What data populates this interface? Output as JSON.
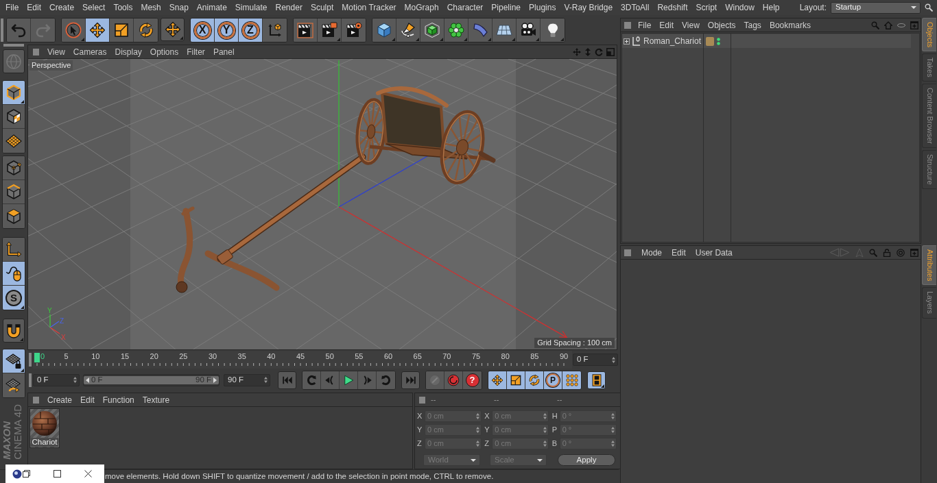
{
  "menu_bar": {
    "items": [
      "File",
      "Edit",
      "Create",
      "Select",
      "Tools",
      "Mesh",
      "Snap",
      "Animate",
      "Simulate",
      "Render",
      "Sculpt",
      "Motion Tracker",
      "MoGraph",
      "Character",
      "Pipeline",
      "Plugins",
      "V-Ray Bridge",
      "3DToAll",
      "Redshift",
      "Script",
      "Window",
      "Help"
    ],
    "layout_label": "Layout:",
    "layout_value": "Startup"
  },
  "toolbar": {
    "groups": [
      [
        {
          "kind": "undo",
          "active": false,
          "disabled": false,
          "submenu": false
        },
        {
          "kind": "redo",
          "active": false,
          "disabled": true,
          "submenu": false
        }
      ],
      [
        {
          "kind": "live-select",
          "active": false,
          "disabled": false,
          "submenu": true
        },
        {
          "kind": "move",
          "active": true,
          "disabled": false,
          "submenu": false
        },
        {
          "kind": "scale",
          "active": false,
          "disabled": false,
          "submenu": false
        },
        {
          "kind": "rotate",
          "active": false,
          "disabled": false,
          "submenu": false
        }
      ],
      [
        {
          "kind": "move",
          "active": false,
          "disabled": false,
          "submenu": true
        }
      ],
      [
        {
          "kind": "axis",
          "label": "X",
          "active": true,
          "disabled": false,
          "submenu": false
        },
        {
          "kind": "axis",
          "label": "Y",
          "active": true,
          "disabled": false,
          "submenu": false
        },
        {
          "kind": "axis",
          "label": "Z",
          "active": true,
          "disabled": false,
          "submenu": false
        },
        {
          "kind": "coords",
          "active": false,
          "disabled": false,
          "submenu": false
        }
      ],
      [
        {
          "kind": "render-view",
          "active": false,
          "disabled": false,
          "submenu": false
        },
        {
          "kind": "render-picture",
          "active": false,
          "disabled": false,
          "submenu": true
        },
        {
          "kind": "render-settings",
          "active": false,
          "disabled": false,
          "submenu": false
        }
      ],
      [
        {
          "kind": "cube",
          "active": false,
          "disabled": false,
          "submenu": true
        },
        {
          "kind": "pen",
          "active": false,
          "disabled": false,
          "submenu": true
        },
        {
          "kind": "subdivision",
          "active": false,
          "disabled": false,
          "submenu": true
        },
        {
          "kind": "cloner",
          "active": false,
          "disabled": false,
          "submenu": true
        },
        {
          "kind": "bend",
          "active": false,
          "disabled": false,
          "submenu": true
        },
        {
          "kind": "floor",
          "active": false,
          "disabled": false,
          "submenu": true
        },
        {
          "kind": "camera",
          "active": false,
          "disabled": false,
          "submenu": true
        },
        {
          "kind": "light",
          "active": false,
          "disabled": false,
          "submenu": true
        }
      ]
    ]
  },
  "tool_palette": {
    "groups": [
      [
        {
          "kind": "globe",
          "active": false,
          "disabled": true,
          "submenu": false
        }
      ],
      [
        {
          "kind": "model",
          "active": true,
          "disabled": false,
          "submenu": true
        },
        {
          "kind": "texture",
          "active": false,
          "disabled": false,
          "submenu": false
        },
        {
          "kind": "workplane",
          "active": false,
          "disabled": false,
          "submenu": false
        }
      ],
      [
        {
          "kind": "points",
          "active": false,
          "disabled": false,
          "submenu": false
        },
        {
          "kind": "edges",
          "active": false,
          "disabled": false,
          "submenu": false
        },
        {
          "kind": "polygons",
          "active": false,
          "disabled": false,
          "submenu": false
        }
      ],
      [
        {
          "kind": "axis-mode",
          "active": false,
          "disabled": false,
          "submenu": false
        },
        {
          "kind": "tweak",
          "active": true,
          "disabled": false,
          "submenu": false
        },
        {
          "kind": "soft",
          "label": "S",
          "active": true,
          "disabled": false,
          "submenu": true
        }
      ],
      [
        {
          "kind": "magnet",
          "active": false,
          "disabled": false,
          "submenu": true
        }
      ],
      [
        {
          "kind": "workplane-lock",
          "active": true,
          "disabled": false,
          "submenu": true
        },
        {
          "kind": "workplane-planar",
          "active": false,
          "disabled": false,
          "submenu": false
        }
      ]
    ]
  },
  "logo": {
    "brand": "MAXON",
    "product": "CINEMA 4D"
  },
  "viewport": {
    "menu": [
      "View",
      "Cameras",
      "Display",
      "Options",
      "Filter",
      "Panel"
    ],
    "camera": "Perspective",
    "grid_info": "Grid Spacing : 100 cm",
    "gizmo": [
      {
        "label": "Y",
        "color": "#3cc83c"
      },
      {
        "label": "Z",
        "color": "#4a64e8"
      },
      {
        "label": "X",
        "color": "#e03c3c"
      }
    ]
  },
  "timeline": {
    "ticks": [
      {
        "label": "0",
        "current": true
      },
      {
        "label": "5",
        "current": false
      },
      {
        "label": "10",
        "current": false
      },
      {
        "label": "15",
        "current": false
      },
      {
        "label": "20",
        "current": false
      },
      {
        "label": "25",
        "current": false
      },
      {
        "label": "30",
        "current": false
      },
      {
        "label": "35",
        "current": false
      },
      {
        "label": "40",
        "current": false
      },
      {
        "label": "45",
        "current": false
      },
      {
        "label": "50",
        "current": false
      },
      {
        "label": "55",
        "current": false
      },
      {
        "label": "60",
        "current": false
      },
      {
        "label": "65",
        "current": false
      },
      {
        "label": "70",
        "current": false
      },
      {
        "label": "75",
        "current": false
      },
      {
        "label": "80",
        "current": false
      },
      {
        "label": "85",
        "current": false
      },
      {
        "label": "90",
        "current": false
      }
    ],
    "playhead": {
      "level": 0
    },
    "frame_field": "0 F"
  },
  "transport": {
    "start_field": "0 F",
    "range": {
      "start": "0 F",
      "end": "90 F",
      "level": 1
    },
    "end_field": "90 F",
    "groups": [
      [
        {
          "kind": "go-start",
          "active": false,
          "disabled": false,
          "submenu": false
        }
      ],
      [
        {
          "kind": "prev-key",
          "active": false,
          "disabled": false,
          "submenu": false
        },
        {
          "kind": "prev-frame",
          "active": false,
          "disabled": false,
          "submenu": false
        },
        {
          "kind": "play",
          "active": false,
          "disabled": false,
          "submenu": false
        },
        {
          "kind": "next-frame",
          "active": false,
          "disabled": false,
          "submenu": false
        },
        {
          "kind": "next-key",
          "active": false,
          "disabled": false,
          "submenu": false
        }
      ],
      [
        {
          "kind": "go-end",
          "active": false,
          "disabled": false,
          "submenu": false
        }
      ],
      [
        {
          "kind": "motion-path",
          "active": false,
          "disabled": true,
          "submenu": false
        },
        {
          "kind": "record",
          "active": false,
          "disabled": false,
          "submenu": false
        },
        {
          "kind": "autokey",
          "label": "?",
          "active": false,
          "disabled": false,
          "submenu": false
        }
      ],
      [
        {
          "kind": "key-position",
          "active": true,
          "disabled": false,
          "submenu": false
        },
        {
          "kind": "key-scale",
          "active": true,
          "disabled": false,
          "submenu": false
        },
        {
          "kind": "key-rotation",
          "active": true,
          "disabled": false,
          "submenu": false
        },
        {
          "kind": "key-parameter",
          "label": "P",
          "active": true,
          "disabled": false,
          "submenu": false
        },
        {
          "kind": "key-pla",
          "active": true,
          "disabled": false,
          "submenu": false
        }
      ],
      [
        {
          "kind": "timeline-film",
          "active": true,
          "disabled": false,
          "submenu": true
        }
      ]
    ]
  },
  "material_manager": {
    "menu": [
      "Create",
      "Edit",
      "Function",
      "Texture"
    ],
    "materials": [
      {
        "name": "Chariot"
      }
    ]
  },
  "coordinates": {
    "headers": [
      "--",
      "--",
      "--"
    ],
    "rows": [
      [
        {
          "axis": "X",
          "value": "0 cm"
        },
        {
          "axis": "X",
          "value": "0 cm"
        },
        {
          "axis": "H",
          "value": "0 °"
        }
      ],
      [
        {
          "axis": "Y",
          "value": "0 cm"
        },
        {
          "axis": "Y",
          "value": "0 cm"
        },
        {
          "axis": "P",
          "value": "0 °"
        }
      ],
      [
        {
          "axis": "Z",
          "value": "0 cm"
        },
        {
          "axis": "Z",
          "value": "0 cm"
        },
        {
          "axis": "B",
          "value": "0 °"
        }
      ]
    ],
    "mode": "World",
    "transform": "Scale",
    "apply": "Apply",
    "disabled": true
  },
  "status_bar": {
    "text": "move elements. Hold down SHIFT to quantize movement / add to the selection in point mode, CTRL to remove."
  },
  "object_manager": {
    "menu": [
      "File",
      "Edit",
      "View",
      "Objects",
      "Tags",
      "Bookmarks"
    ],
    "objects": [
      {
        "name": "Roman_Chariot",
        "expanded": false
      }
    ]
  },
  "side_tabs": [
    {
      "label": "Objects",
      "selected": true
    },
    {
      "label": "Takes",
      "selected": false
    },
    {
      "label": "Content Browser",
      "selected": false
    },
    {
      "label": "Structure",
      "selected": false
    }
  ],
  "attribute_manager": {
    "menu": [
      "Mode",
      "Edit",
      "User Data"
    ]
  },
  "attribute_tabs": [
    {
      "label": "Attributes",
      "selected": true
    },
    {
      "label": "Layers",
      "selected": false
    }
  ]
}
